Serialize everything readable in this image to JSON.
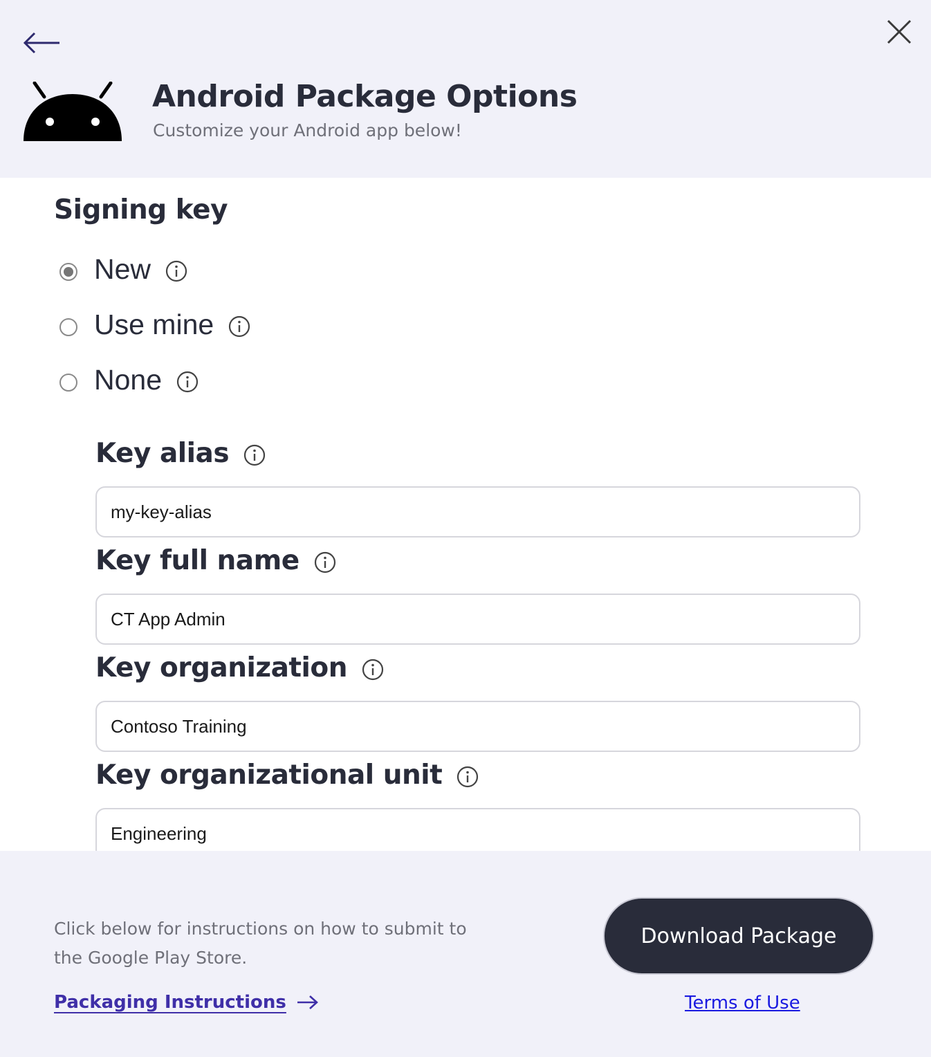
{
  "header": {
    "title": "Android Package Options",
    "subtitle": "Customize your Android app below!"
  },
  "signing": {
    "section_title": "Signing key",
    "options": [
      {
        "label": "New",
        "checked": true
      },
      {
        "label": "Use mine",
        "checked": false
      },
      {
        "label": "None",
        "checked": false
      }
    ]
  },
  "fields": {
    "key_alias": {
      "label": "Key alias",
      "value": "my-key-alias"
    },
    "key_full_name": {
      "label": "Key full name",
      "value": "CT App Admin"
    },
    "key_organization": {
      "label": "Key organization",
      "value": "Contoso Training"
    },
    "key_org_unit": {
      "label": "Key organizational unit",
      "value": "Engineering"
    }
  },
  "footer": {
    "instructions_text": "Click below for instructions on how to submit to the Google Play Store.",
    "packaging_link": "Packaging Instructions",
    "download_button": "Download Package",
    "terms_link": "Terms of Use"
  },
  "colors": {
    "header_bg": "#f1f1f9",
    "dark": "#292c3a",
    "link_purple": "#3f2fa8",
    "link_blue": "#1a1ae0"
  }
}
